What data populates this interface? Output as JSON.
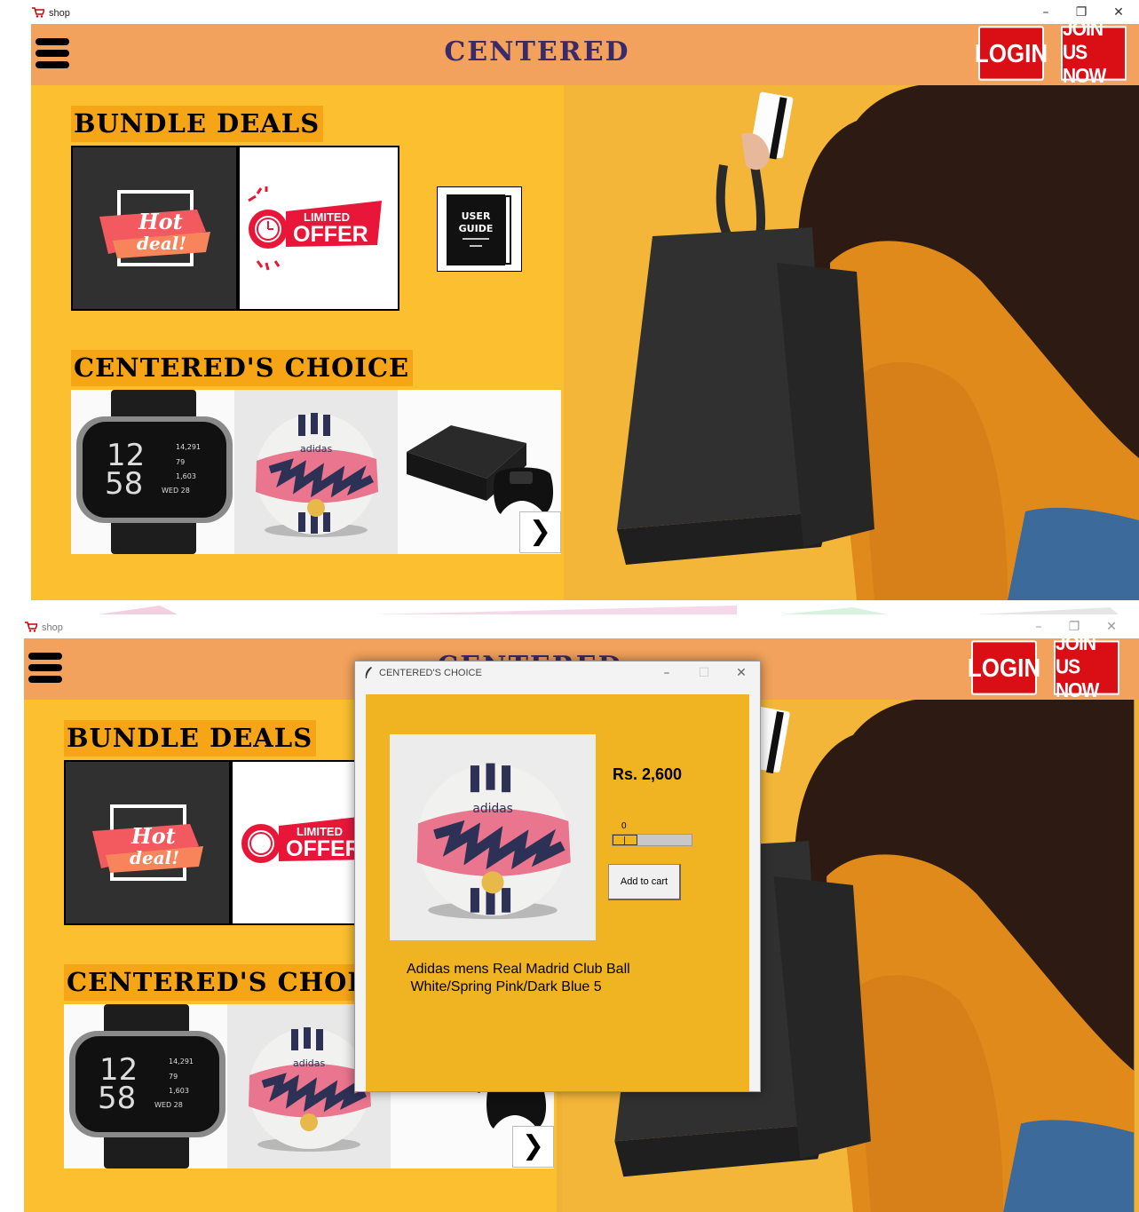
{
  "window": {
    "title": "shop",
    "minimize_glyph": "–",
    "restore_glyph": "❐",
    "close_glyph": "✕"
  },
  "header": {
    "brand": "CENTERED",
    "login_label": "LOGIN",
    "join_label": "JOIN US NOW"
  },
  "bundle": {
    "title": "BUNDLE DEALS",
    "hot_deal_line1": "Hot",
    "hot_deal_line2": "deal!",
    "limited_line1": "LIMITED",
    "limited_line2": "OFFER",
    "guide_line1": "USER",
    "guide_line2": "GUIDE"
  },
  "choice": {
    "title": "CENTERED'S CHOICE",
    "watch": {
      "hour": "12",
      "minute": "58",
      "steps": "14,291",
      "heart": "79",
      "calories": "1,603",
      "date": "WED 28"
    },
    "ball_brand": "adidas",
    "next_glyph": "❯"
  },
  "dialog": {
    "title": "CENTERED'S CHOICE",
    "price": "Rs. 2,600",
    "quantity": 0,
    "quantity_label": "0",
    "add_to_cart": "Add to cart",
    "description": "Adidas mens Real Madrid Club Ball\n White/Spring Pink/Dark Blue 5",
    "ball_brand": "adidas"
  },
  "colors": {
    "topbar": "#f2a25c",
    "background": "#fbbf2f",
    "brand_text": "#3a2a6a",
    "button_red": "#d90f15",
    "dialog_body": "#f0b322"
  }
}
